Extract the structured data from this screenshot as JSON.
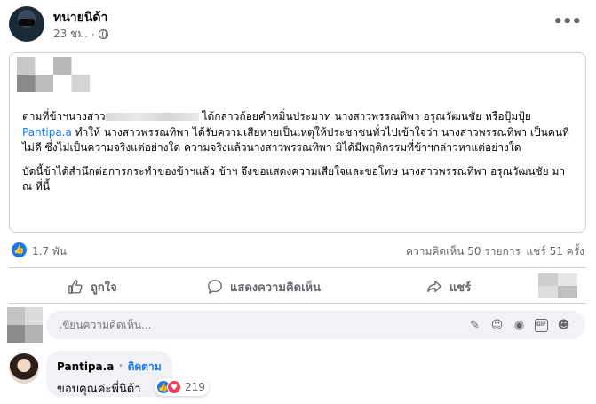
{
  "post": {
    "author": "ทนายนิด้า",
    "time": "23 ชม.",
    "privacy_icon": "globe-icon",
    "paragraph1_part1": "ตามที่ข้าฯนางสาว",
    "paragraph1_part2": " ได้กล่าวถ้อยคำหมิ่นประมาท นางสาวพรรณทิพา อรุณวัฒนชัย หรือปุ้มปุ้ย ",
    "mention": "Pantipa.a",
    "paragraph1_part3": " ทำให้ นางสาวพรรณทิพา ได้รับความเสียหายเป็นเหตุให้ประชาชนทั่วไปเข้าใจว่า นางสาวพรรณทิพา เป็นคนที่ไม่ดี ซึ่งไม่เป็นความจริงแต่อย่างใด ความจริงแล้วนางสาวพรรณทิพา มิได้มีพฤติกรรมที่ข้าฯกล่าวหาแต่อย่างใด",
    "paragraph2": "บัดนี้ข้าได้สำนึกต่อการกระทำของข้าฯแล้ว ข้าฯ จึงขอแสดงความเสียใจและขอโทษ นางสาวพรรณทิพา อรุณวัฒนชัย มา ณ ที่นี้"
  },
  "stats": {
    "reactions": "1.7 พัน",
    "comments": "ความคิดเห็น 50 รายการ",
    "shares": "แชร์ 51 ครั้ง"
  },
  "actions": {
    "like": "ถูกใจ",
    "comment": "แสดงความคิดเห็น",
    "share": "แชร์"
  },
  "composer": {
    "placeholder": "เขียนความคิดเห็น..."
  },
  "reply": {
    "name": "Pantipa.a",
    "separator": "·",
    "follow": "ติดตาม",
    "text": "ขอบคุณค่ะพี่นิด้า",
    "reaction_count": "219"
  },
  "colors": {
    "accent": "#1877f2",
    "love": "#f33e58",
    "muted": "#65676b"
  }
}
